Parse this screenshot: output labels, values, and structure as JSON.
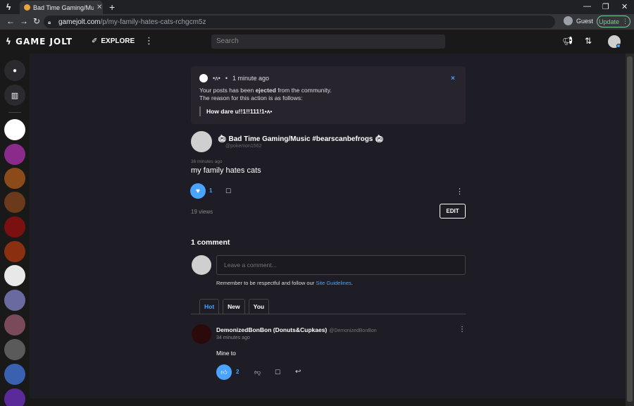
{
  "browser": {
    "tab_title": "Bad Time Gaming/Music #bear",
    "tab_close": "✕",
    "new_tab": "+",
    "url_host": "gamejolt.com",
    "url_path": "/p/my-family-hates-cats-rchgcm5z",
    "profile_label": "Guest",
    "update_label": "Update",
    "icons": [
      "gamejolt-app-icon",
      "back-icon",
      "forward-icon",
      "reload-icon",
      "lock-icon",
      "minimize-icon",
      "restore-icon",
      "close-icon"
    ]
  },
  "header": {
    "logo": "GAME JOLT",
    "explore_label": "EXPLORE",
    "search_placeholder": "Search"
  },
  "notice": {
    "author": "•ʌ•",
    "time": "1 minute ago",
    "close": "×",
    "line1_prefix": "Your posts has been ",
    "line1_bold": "ejected",
    "line1_suffix": " from the community.",
    "line2": "The reason for this action is as follows:",
    "reason": "How dare u!!1!!111!1•ʌ•"
  },
  "post": {
    "author": "Bad Time Gaming/Music #bearscanbefrogs",
    "handle": "@pokemon1562",
    "time": "36 minutes ago",
    "title": "my family hates cats",
    "like_count": "1",
    "views": "19 views",
    "edit_label": "EDIT"
  },
  "comments": {
    "title": "1 comment",
    "input_placeholder": "Leave a comment...",
    "guideline_prefix": "Remember to be respectful and follow our ",
    "guideline_link": "Site Guidelines",
    "guideline_suffix": ".",
    "sort_tabs": [
      "Hot",
      "New",
      "You"
    ],
    "items": [
      {
        "author": "DemonizedBonBon (Donuts&Cupkaes)",
        "handle": "@DemonizedBonBon",
        "time": "34 minutes ago",
        "body": "Mine to",
        "like_count": "2"
      }
    ]
  },
  "colors": {
    "accent": "#4aa3ff",
    "background": "#1e1c24",
    "header": "#191919"
  }
}
